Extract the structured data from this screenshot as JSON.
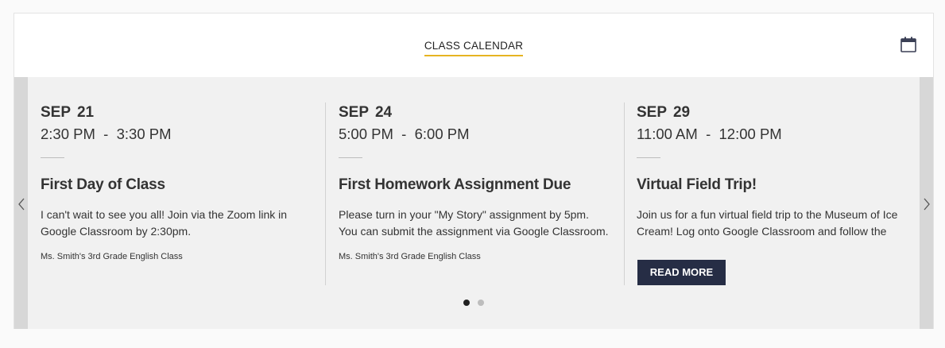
{
  "header": {
    "title": "CLASS CALENDAR",
    "calendar_icon": "calendar-icon",
    "accent_color": "#e6b422"
  },
  "navigation": {
    "prev_icon": "chevron-left-icon",
    "next_icon": "chevron-right-icon"
  },
  "events": [
    {
      "date": "SEP 21",
      "time": "2:30 PM  -  3:30 PM",
      "title": "First Day of Class",
      "description": "I can't wait to see you all! Join via the Zoom link in Google Classroom by 2:30pm.",
      "organizer": "Ms. Smith's 3rd Grade English Class"
    },
    {
      "date": "SEP 24",
      "time": "5:00 PM  -  6:00 PM",
      "title": "First Homework Assignment Due",
      "description": "Please turn in your \"My Story\" assignment by 5pm. You can submit the assignment via Google Classroom.",
      "organizer": "Ms. Smith's 3rd Grade English Class"
    },
    {
      "date": "SEP 29",
      "time": "11:00 AM  -  12:00 PM",
      "title": "Virtual Field Trip!",
      "description": "Join us for a fun virtual field trip to the Museum of Ice Cream! Log onto Google Classroom and follow the",
      "button_label": "READ MORE",
      "button_color": "#262d45"
    }
  ],
  "pagination": {
    "total_pages": 2,
    "active_page": 1
  }
}
